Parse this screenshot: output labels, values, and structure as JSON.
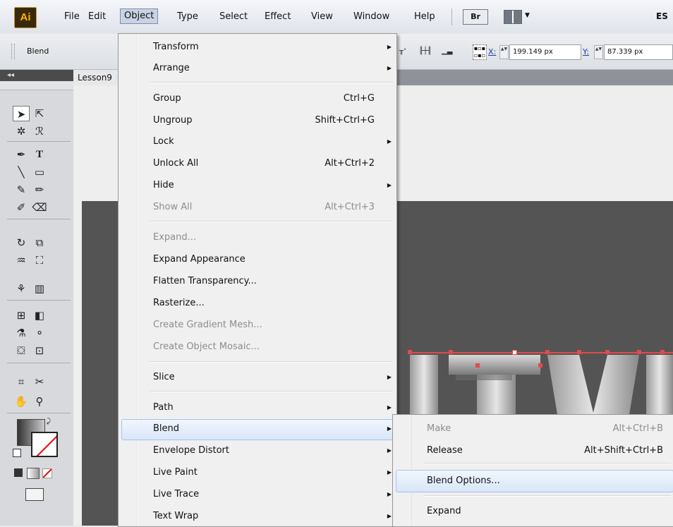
{
  "app": {
    "logo": "Ai"
  },
  "menubar": {
    "items": [
      "File",
      "Edit",
      "Object",
      "Type",
      "Select",
      "Effect",
      "View",
      "Window",
      "Help"
    ],
    "bridge_label": "Br",
    "workspace_label": "ES"
  },
  "controlbar": {
    "selection_label": "Blend",
    "x_label": "X:",
    "x_value": "199.149 px",
    "y_label": "Y:",
    "y_value": "87.339 px"
  },
  "document": {
    "tab_title": "Lesson9"
  },
  "object_menu": {
    "items": [
      {
        "label": "Transform",
        "submenu": true
      },
      {
        "label": "Arrange",
        "submenu": true
      },
      {
        "label": "Group",
        "shortcut": "Ctrl+G"
      },
      {
        "label": "Ungroup",
        "shortcut": "Shift+Ctrl+G"
      },
      {
        "label": "Lock",
        "submenu": true
      },
      {
        "label": "Unlock All",
        "shortcut": "Alt+Ctrl+2"
      },
      {
        "label": "Hide",
        "submenu": true
      },
      {
        "label": "Show All",
        "shortcut": "Alt+Ctrl+3",
        "disabled": true
      },
      {
        "label": "Expand...",
        "disabled": true
      },
      {
        "label": "Expand Appearance"
      },
      {
        "label": "Flatten Transparency..."
      },
      {
        "label": "Rasterize..."
      },
      {
        "label": "Create Gradient Mesh...",
        "disabled": true
      },
      {
        "label": "Create Object Mosaic...",
        "disabled": true
      },
      {
        "label": "Slice",
        "submenu": true
      },
      {
        "label": "Path",
        "submenu": true
      },
      {
        "label": "Blend",
        "submenu": true,
        "highlighted": true
      },
      {
        "label": "Envelope Distort",
        "submenu": true
      },
      {
        "label": "Live Paint",
        "submenu": true
      },
      {
        "label": "Live Trace",
        "submenu": true
      },
      {
        "label": "Text Wrap",
        "submenu": true
      }
    ]
  },
  "blend_submenu": {
    "items": [
      {
        "label": "Make",
        "shortcut": "Alt+Ctrl+B",
        "disabled": true
      },
      {
        "label": "Release",
        "shortcut": "Alt+Shift+Ctrl+B"
      },
      {
        "label": "Blend Options...",
        "highlighted": true
      },
      {
        "label": "Expand"
      }
    ]
  },
  "icons": {
    "submenu_arrow": "▶",
    "spinner": "▲▼"
  },
  "colors": {
    "selection": "#e24a4a",
    "menu_highlight": "#d9e6f8",
    "artboard": "#545454"
  }
}
